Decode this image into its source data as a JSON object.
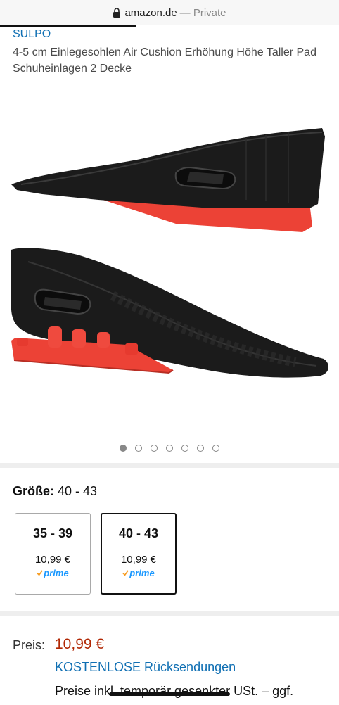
{
  "browser": {
    "domain": "amazon.de",
    "mode": "— Private"
  },
  "product": {
    "brand": "SULPO",
    "title": "4-5 cm Einlegesohlen Air Cushion Erhöhung Höhe Taller Pad Schuheinlagen 2 Decke",
    "image_icon": "insole-product-image"
  },
  "carousel": {
    "count": 7,
    "active_index": 0
  },
  "size": {
    "label": "Größe:",
    "selected_value": "40 - 43",
    "options": [
      {
        "name": "35 - 39",
        "price": "10,99 €",
        "badge": "prime",
        "selected": false
      },
      {
        "name": "40 - 43",
        "price": "10,99 €",
        "badge": "prime",
        "selected": true
      }
    ]
  },
  "pricing": {
    "label": "Preis:",
    "value": "10,99 €",
    "returns_link": "KOSTENLOSE Rücksendungen",
    "tax_note": "Preise inkl. temporär gesenkter USt. – ggf."
  },
  "colors": {
    "link": "#0f6fb3",
    "price": "#b12704",
    "prime": "#1a98ff",
    "prime_check": "#f79b1e"
  }
}
